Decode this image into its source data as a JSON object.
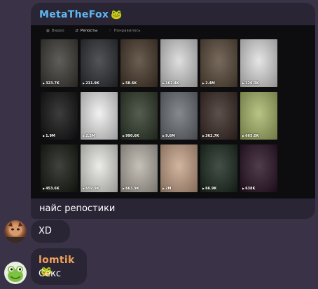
{
  "messages": {
    "first": {
      "sender": "MetaTheFox",
      "sender_emoji": "🐸",
      "text": "найс репостики",
      "screenshot": {
        "tabs": [
          {
            "label": "Видео",
            "icon": "grid-icon",
            "active": false
          },
          {
            "label": "Репосты",
            "icon": "repost-icon",
            "active": true
          },
          {
            "label": "Понравилось",
            "icon": "heart-icon",
            "active": false
          }
        ],
        "tiles": [
          {
            "views": "323.7K",
            "bg": "#3d3a36",
            "caption": ""
          },
          {
            "views": "211.9K",
            "bg": "#2c2f33",
            "caption": ""
          },
          {
            "views": "58.6K",
            "bg": "#4a3a2c",
            "caption": ""
          },
          {
            "views": "162.4K",
            "bg": "#d8d8d8",
            "caption": ""
          },
          {
            "views": "2.4M",
            "bg": "#5a4a3a",
            "caption": ""
          },
          {
            "views": "126.3K",
            "bg": "#e0e0e0",
            "caption": ""
          },
          {
            "views": "1.9M",
            "bg": "#111111",
            "caption": ""
          },
          {
            "views": "2.3M",
            "bg": "#efefef",
            "caption": ""
          },
          {
            "views": "990.6K",
            "bg": "#2f3a2a",
            "caption": ""
          },
          {
            "views": "9.6M",
            "bg": "#6b6f75",
            "caption": ""
          },
          {
            "views": "362.7K",
            "bg": "#3a2a24",
            "caption": ""
          },
          {
            "views": "665.0K",
            "bg": "#a8b86a",
            "caption": ""
          },
          {
            "views": "453.6K",
            "bg": "#161a12",
            "caption": ""
          },
          {
            "views": "659.9K",
            "bg": "#e8e8e4",
            "caption": ""
          },
          {
            "views": "663.9K",
            "bg": "#b9b2a8",
            "caption": ""
          },
          {
            "views": "2M",
            "bg": "#c9a58a",
            "caption": ""
          },
          {
            "views": "66.9K",
            "bg": "#1b2a1f",
            "caption": ""
          },
          {
            "views": "638K",
            "bg": "#2a1224",
            "caption": ""
          }
        ]
      }
    },
    "second": {
      "text": "XD"
    },
    "third": {
      "sender": "lomtik",
      "sender_emoji": "🐸",
      "text": "Секс"
    }
  },
  "colors": {
    "background": "#3a3246",
    "bubble": "#2a2535",
    "sender_meta": "#5fb8f2",
    "sender_lomtik": "#f0a05a"
  }
}
